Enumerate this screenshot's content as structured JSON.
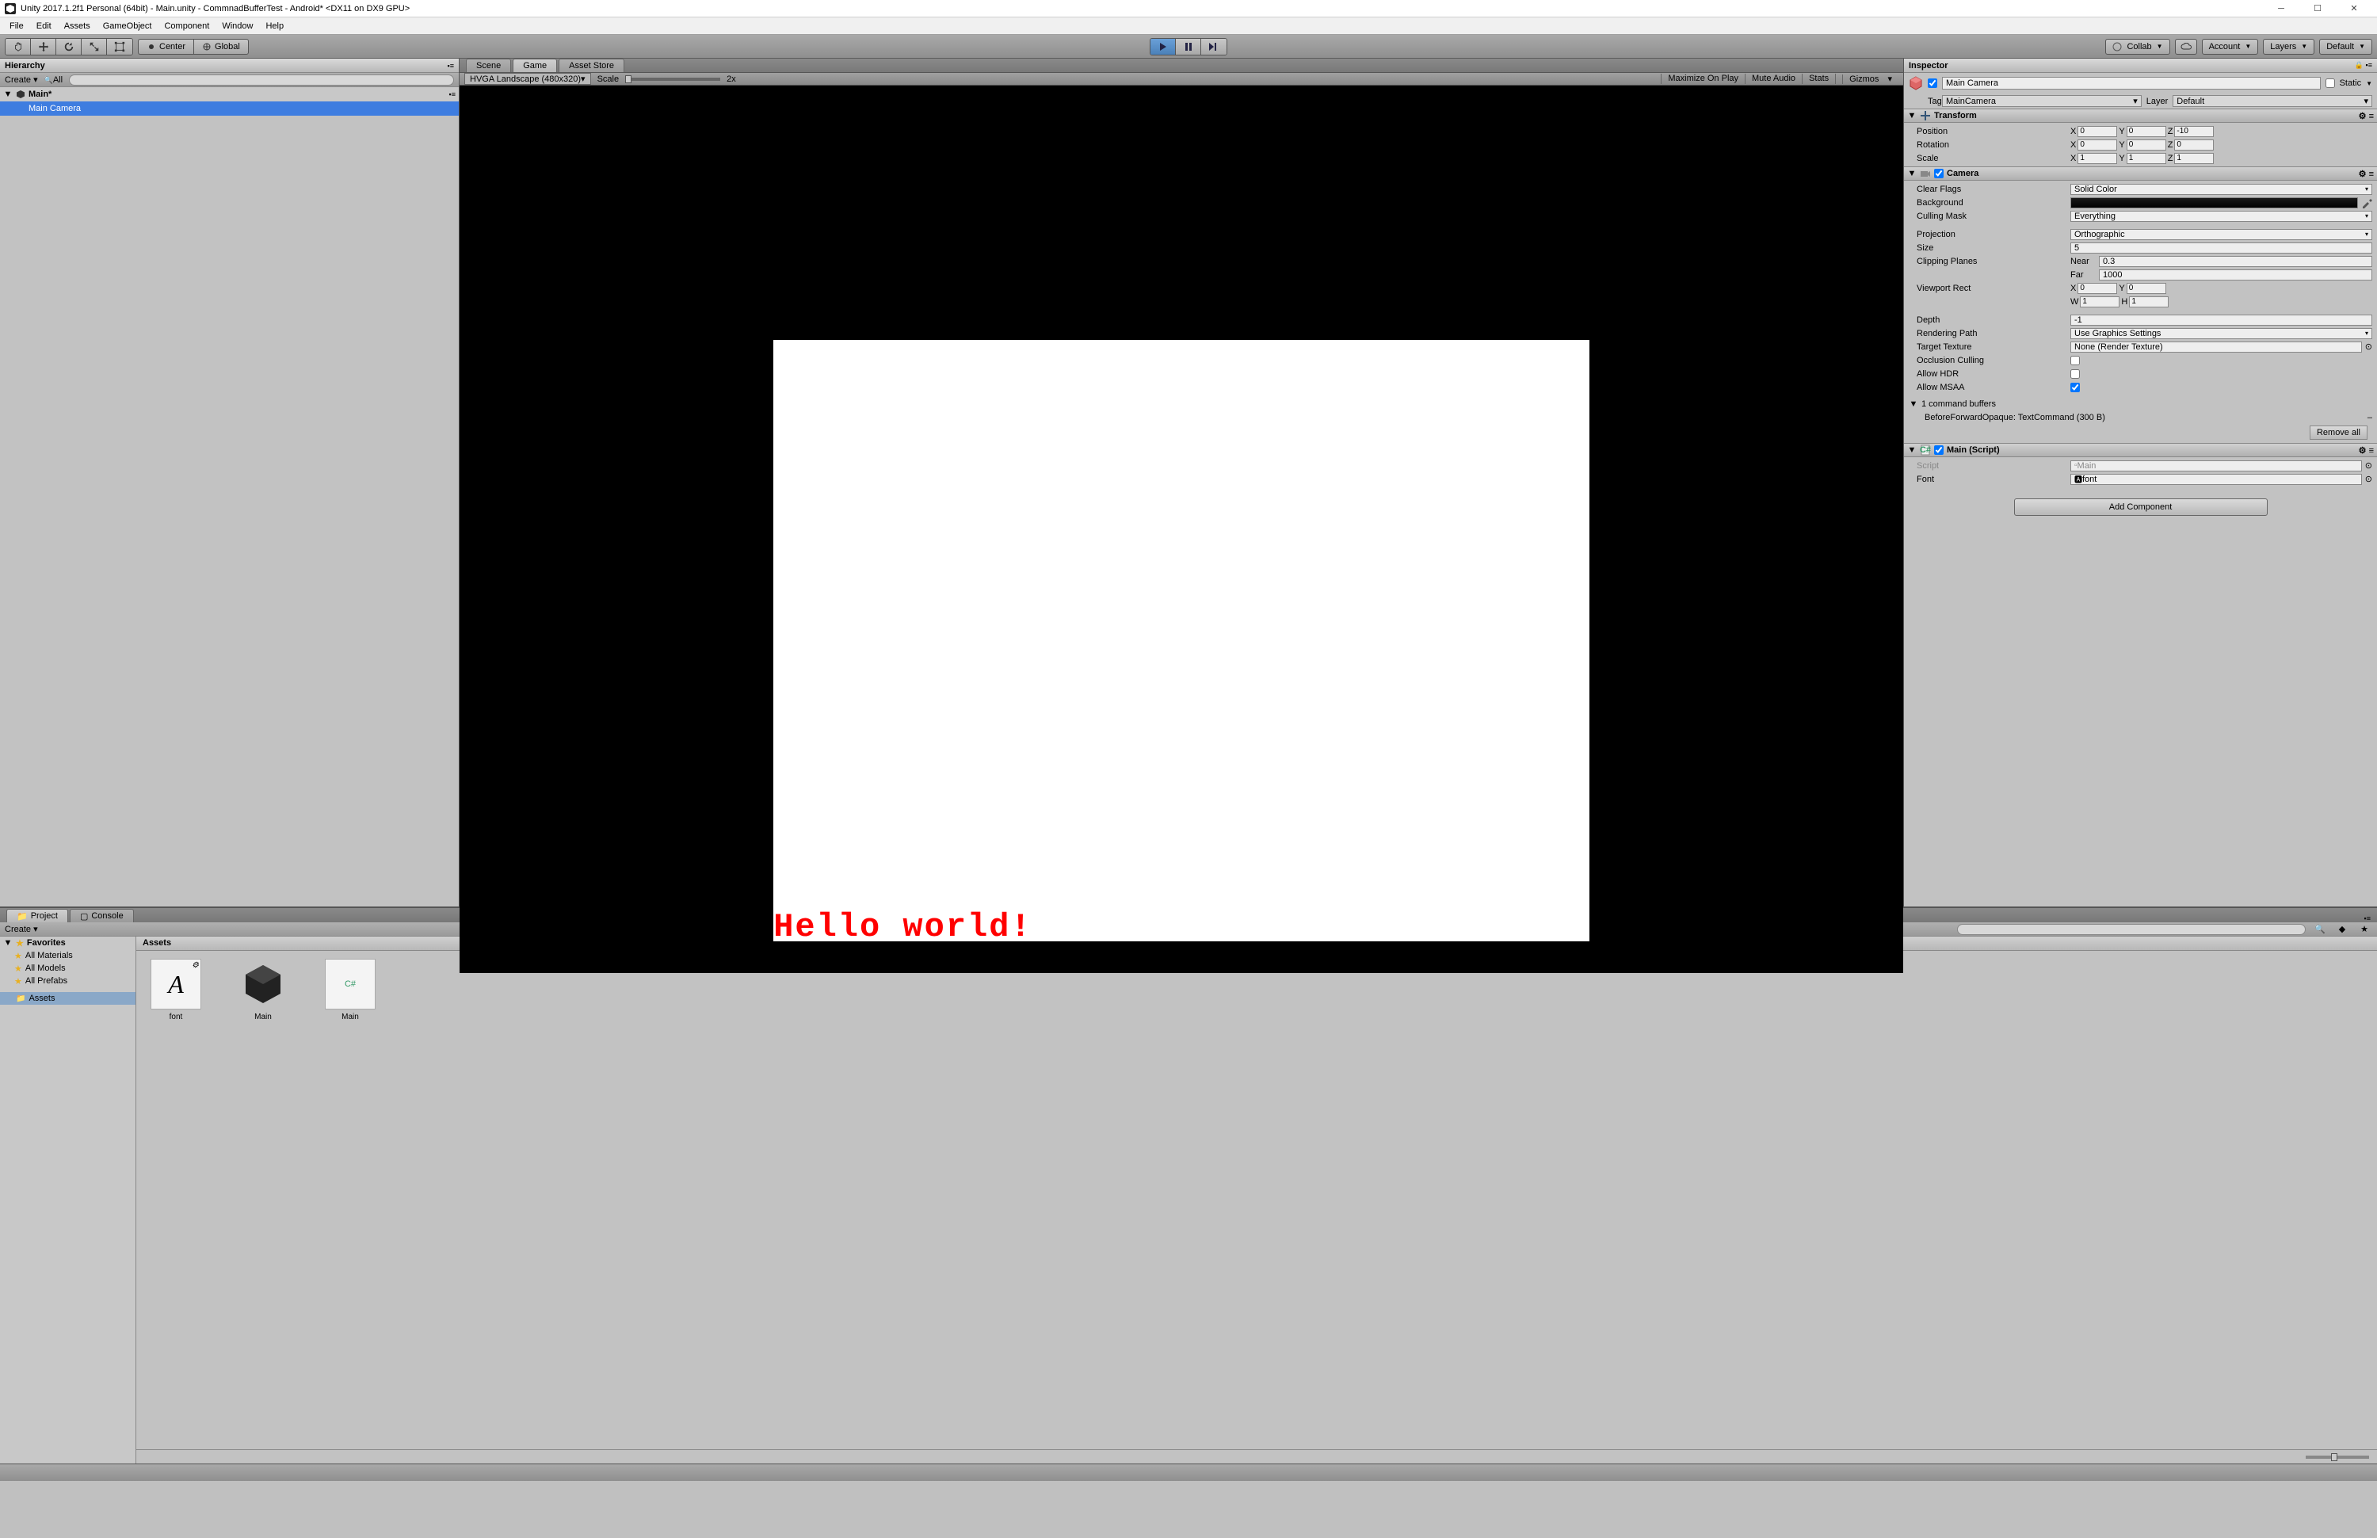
{
  "window": {
    "title": "Unity 2017.1.2f1 Personal (64bit) - Main.unity - CommnadBufferTest - Android* <DX11 on DX9 GPU>"
  },
  "menu": [
    "File",
    "Edit",
    "Assets",
    "GameObject",
    "Component",
    "Window",
    "Help"
  ],
  "toolbar": {
    "center": "Center",
    "global": "Global",
    "collab": "Collab",
    "account": "Account",
    "layers": "Layers",
    "layout": "Default"
  },
  "hierarchy": {
    "title": "Hierarchy",
    "create": "Create",
    "all": "All",
    "scene": "Main*",
    "items": [
      "Main Camera"
    ]
  },
  "center_tabs": {
    "scene": "Scene",
    "game": "Game",
    "asset_store": "Asset Store"
  },
  "game_toolbar": {
    "aspect": "HVGA Landscape (480x320)",
    "scale_label": "Scale",
    "scale_value": "2x",
    "maximize": "Maximize On Play",
    "mute": "Mute Audio",
    "stats": "Stats",
    "gizmos": "Gizmos"
  },
  "game_view": {
    "text": "Hello world!"
  },
  "inspector": {
    "title": "Inspector",
    "object_name": "Main Camera",
    "static_label": "Static",
    "tag_label": "Tag",
    "tag_value": "MainCamera",
    "layer_label": "Layer",
    "layer_value": "Default",
    "transform": {
      "title": "Transform",
      "position": {
        "label": "Position",
        "x": "0",
        "y": "0",
        "z": "-10"
      },
      "rotation": {
        "label": "Rotation",
        "x": "0",
        "y": "0",
        "z": "0"
      },
      "scale": {
        "label": "Scale",
        "x": "1",
        "y": "1",
        "z": "1"
      }
    },
    "camera": {
      "title": "Camera",
      "clear_flags": {
        "label": "Clear Flags",
        "value": "Solid Color"
      },
      "background": {
        "label": "Background"
      },
      "culling_mask": {
        "label": "Culling Mask",
        "value": "Everything"
      },
      "projection": {
        "label": "Projection",
        "value": "Orthographic"
      },
      "size": {
        "label": "Size",
        "value": "5"
      },
      "clipping": {
        "label": "Clipping Planes",
        "near_label": "Near",
        "near": "0.3",
        "far_label": "Far",
        "far": "1000"
      },
      "viewport": {
        "label": "Viewport Rect",
        "x": "0",
        "y": "0",
        "w": "1",
        "h": "1"
      },
      "depth": {
        "label": "Depth",
        "value": "-1"
      },
      "rendering_path": {
        "label": "Rendering Path",
        "value": "Use Graphics Settings"
      },
      "target_texture": {
        "label": "Target Texture",
        "value": "None (Render Texture)"
      },
      "occlusion": {
        "label": "Occlusion Culling"
      },
      "hdr": {
        "label": "Allow HDR"
      },
      "msaa": {
        "label": "Allow MSAA"
      },
      "command_buffers": {
        "label": "1 command buffers",
        "item": "BeforeForwardOpaque: TextCommand (300 B)",
        "remove": "Remove all"
      }
    },
    "main_script": {
      "title": "Main (Script)",
      "script_label": "Script",
      "script_value": "Main",
      "font_label": "Font",
      "font_value": "font"
    },
    "add_component": "Add Component"
  },
  "project": {
    "tab": "Project",
    "console": "Console",
    "create": "Create",
    "favorites": "Favorites",
    "fav_items": [
      "All Materials",
      "All Models",
      "All Prefabs"
    ],
    "assets": "Assets",
    "crumb": "Assets",
    "items": [
      {
        "name": "font",
        "type": "font"
      },
      {
        "name": "Main",
        "type": "scene"
      },
      {
        "name": "Main",
        "type": "script"
      }
    ]
  }
}
